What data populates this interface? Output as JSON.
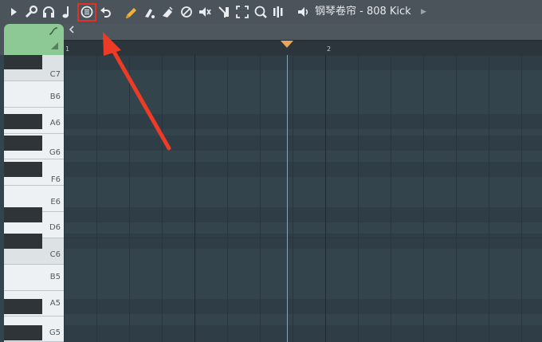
{
  "window_title": "钢琴卷帘 - 808 Kick",
  "toolbar": {
    "icons": [
      "menu-arrow-icon",
      "wrench-icon",
      "headphones-icon",
      "note-icon",
      "snap-icon",
      "undo-icon",
      "pencil-icon",
      "brush-icon",
      "eraser-icon",
      "mute-icon",
      "speaker-mute-icon",
      "slice-icon",
      "select-icon",
      "zoom-icon",
      "playback-icon",
      "speaker-icon"
    ],
    "highlight_color": "#e0302a"
  },
  "channel_tab": {
    "color": "#8dc995"
  },
  "ruler": {
    "bars": [
      "1",
      "2"
    ]
  },
  "keyboard": {
    "labels": [
      "C7",
      "B6",
      "A6",
      "G6",
      "F6",
      "E6",
      "D6",
      "C6",
      "B5",
      "A5",
      "G5"
    ]
  },
  "annotation": {
    "arrow_color": "#ee3b26"
  }
}
